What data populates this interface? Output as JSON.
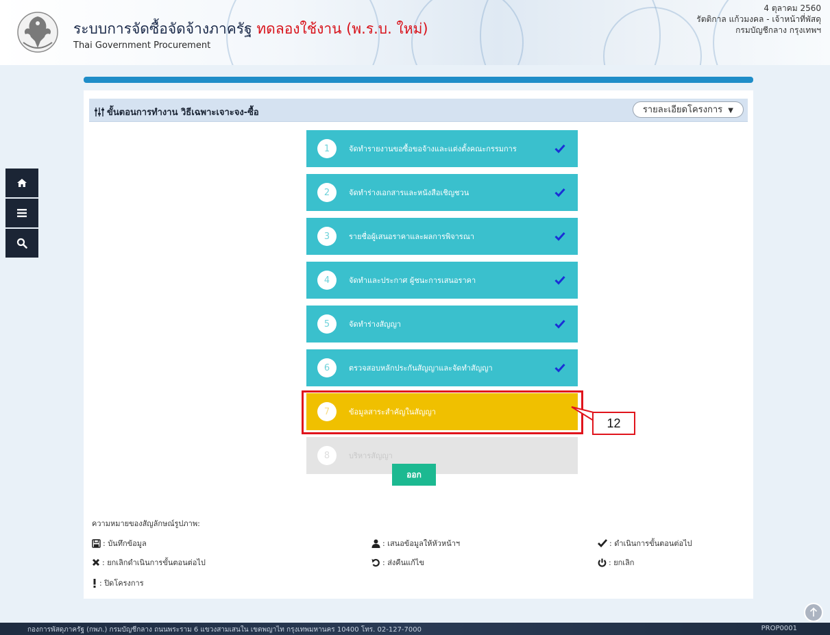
{
  "header": {
    "title": "ระบบการจัดซื้อจัดจ้างภาครัฐ",
    "title_trial": "ทดลองใช้งาน (พ.ร.บ. ใหม่)",
    "subtitle": "Thai Government Procurement",
    "date": "4 ตุลาคม 2560",
    "user": "รัตติกาล แก้วมงคล - เจ้าหน้าที่พัสดุ",
    "department": "กรมบัญชีกลาง กรุงเทพฯ"
  },
  "sidebar": [
    "home-icon",
    "menu-icon",
    "search-icon"
  ],
  "panel": {
    "title": "ขั้นตอนการทำงาน วิธีเฉพาะเจาะจง-ซื้อ",
    "project_button": "รายละเอียดโครงการ"
  },
  "steps": [
    {
      "num": "1",
      "label": "จัดทำรายงานขอซื้อขอจ้างและแต่งตั้งคณะกรรมการ",
      "status": "done"
    },
    {
      "num": "2",
      "label": "จัดทำร่างเอกสารและหนังสือเชิญชวน",
      "status": "done"
    },
    {
      "num": "3",
      "label": "รายชื่อผู้เสนอราคาและผลการพิจารณา",
      "status": "done"
    },
    {
      "num": "4",
      "label": "จัดทำและประกาศ ผู้ชนะการเสนอราคา",
      "status": "done"
    },
    {
      "num": "5",
      "label": "จัดทำร่างสัญญา",
      "status": "done"
    },
    {
      "num": "6",
      "label": "ตรวจสอบหลักประกันสัญญาและจัดทำสัญญา",
      "status": "done"
    },
    {
      "num": "7",
      "label": "ข้อมูลสาระสำคัญในสัญญา",
      "status": "current"
    },
    {
      "num": "8",
      "label": "บริหารสัญญา",
      "status": "pending"
    }
  ],
  "callout": "12",
  "exit_button": "ออก",
  "legend": {
    "title": "ความหมายของสัญลักษณ์รูปภาพ:",
    "save": ": บันทึกข้อมูล",
    "submit": ": เสนอข้อมูลให้หัวหน้าฯ",
    "proceed": ": ดำเนินการขั้นตอนต่อไป",
    "cancel_proceed": ": ยกเลิกดำเนินการขั้นตอนต่อไป",
    "return": ": ส่งคืนแก้ไข",
    "cancel": ": ยกเลิก",
    "close": ": ปิดโครงการ"
  },
  "footer": {
    "address": "กองการพัสดุภาครัฐ (กพภ.) กรมบัญชีกลาง ถนนพระราม 6 แขวงสามเสนใน เขตพญาไท กรุงเทพมหานคร 10400 โทร. 02-127-7000",
    "code": "PROP0001"
  },
  "colors": {
    "done": "#3ac0cd",
    "current": "#f0c000",
    "pending": "#e4e4e4",
    "exit": "#1cb991",
    "highlight": "#e0141c",
    "header_bar": "#1f8dc8"
  }
}
